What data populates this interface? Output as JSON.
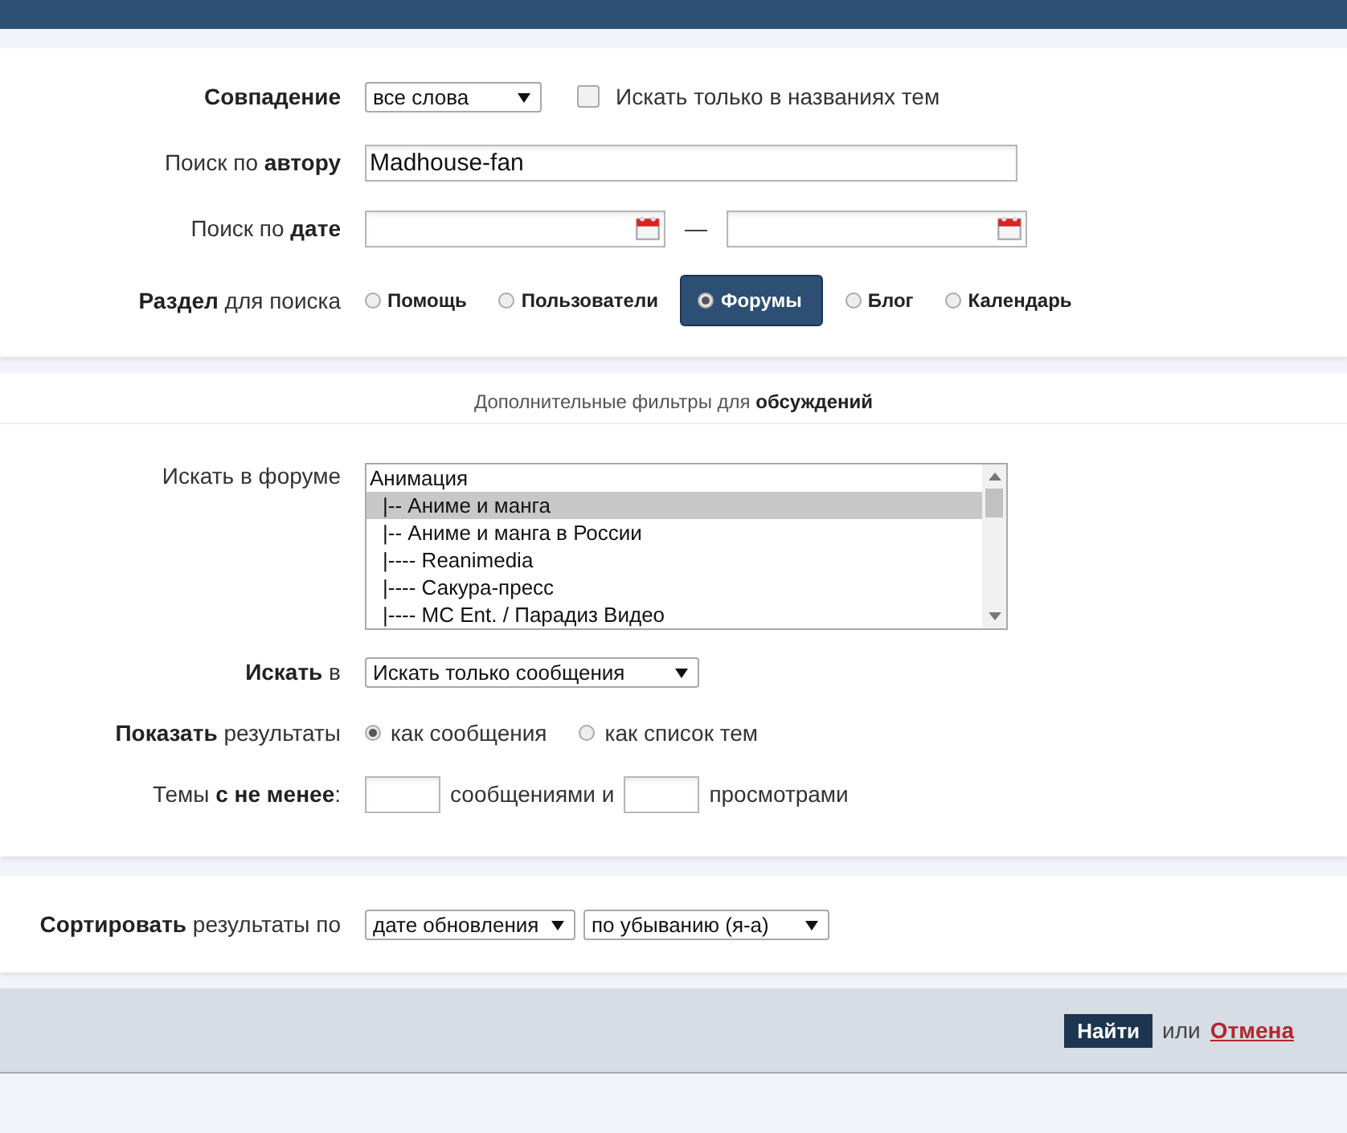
{
  "match": {
    "label": "Совпадение",
    "value": "все слова",
    "checkbox": {
      "label": "Искать только в названиях тем",
      "checked": false
    }
  },
  "author": {
    "label": "Поиск по **автору**",
    "value": "Madhouse-fan"
  },
  "date": {
    "label": "Поиск по **дате**",
    "separator": "—"
  },
  "section": {
    "label": "**Раздел** для поиска",
    "options": [
      {
        "label": "Помощь",
        "selected": false
      },
      {
        "label": "Пользователи",
        "selected": false
      },
      {
        "label": "Форумы",
        "selected": true
      },
      {
        "label": "Блог",
        "selected": false
      },
      {
        "label": "Календарь",
        "selected": false
      }
    ]
  },
  "filters_heading": "Дополнительные фильтры для **обсуждений**",
  "forum": {
    "label": "Искать в форуме",
    "items": [
      {
        "label": "Анимация",
        "kind": "category",
        "selected": false
      },
      {
        "label": "|-- Аниме и манга",
        "kind": "forum",
        "selected": true
      },
      {
        "label": "|-- Аниме и манга в России",
        "kind": "forum",
        "selected": false
      },
      {
        "label": "|---- Reanimedia",
        "kind": "forum",
        "selected": false
      },
      {
        "label": "|---- Сакура-пресс",
        "kind": "forum",
        "selected": false
      },
      {
        "label": "|---- MC Ent. / Парадиз Видео",
        "kind": "forum",
        "selected": false
      }
    ]
  },
  "search_in": {
    "label": "**Искать** в",
    "value": "Искать только сообщения"
  },
  "show": {
    "label": "**Показать** результаты",
    "options": [
      {
        "label": "как сообщения",
        "selected": true
      },
      {
        "label": "как список тем",
        "selected": false
      }
    ]
  },
  "minimum": {
    "label": "Темы **с не менее**:",
    "after_first": "сообщениями и",
    "after_second": "просмотрами"
  },
  "sort": {
    "label": "**Сортировать** результаты по",
    "field": "дате обновления",
    "order": "по убыванию (я-а)"
  },
  "footer": {
    "submit": "Найти",
    "or": "или",
    "cancel": "Отмена"
  }
}
